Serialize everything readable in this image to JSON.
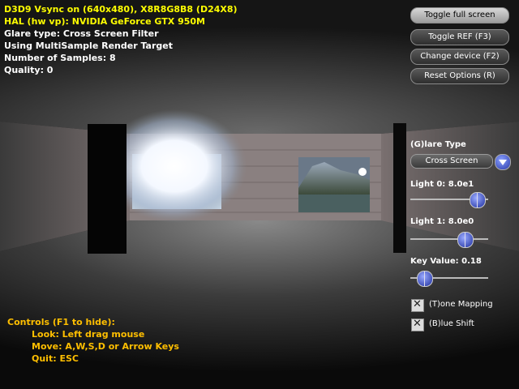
{
  "stats": {
    "line1": "D3D9 Vsync on (640x480), X8R8G8B8 (D24X8)",
    "line2": "HAL (hw vp): NVIDIA GeForce GTX 950M",
    "line3": "Glare type: Cross Screen Filter",
    "line4": "Using MultiSample Render Target",
    "line5": "Number of Samples: 8",
    "line6": "Quality: 0",
    "color_line1": "#ffff00",
    "color_line2": "#ffff00",
    "color_rest": "#ffffff"
  },
  "buttons": {
    "toggle_full_screen": "Toggle full screen",
    "toggle_ref": "Toggle REF (F3)",
    "change_device": "Change device (F2)",
    "reset_options": "Reset Options (R)"
  },
  "glare": {
    "label": "(G)lare Type",
    "selected": "Cross Screen"
  },
  "sliders": {
    "light0": {
      "label": "Light 0: 8.0e1",
      "level": 0.85
    },
    "light1": {
      "label": "Light 1: 8.0e0",
      "level": 0.7
    },
    "key": {
      "label": "Key Value: 0.18",
      "level": 0.18
    }
  },
  "checkboxes": {
    "tone_mapping": "(T)one Mapping",
    "blue_shift": "(B)lue Shift"
  },
  "controls": {
    "title": "Controls (F1 to hide):",
    "look": "Look: Left drag mouse",
    "move": "Move: A,W,S,D or Arrow Keys",
    "quit": "Quit: ESC"
  }
}
